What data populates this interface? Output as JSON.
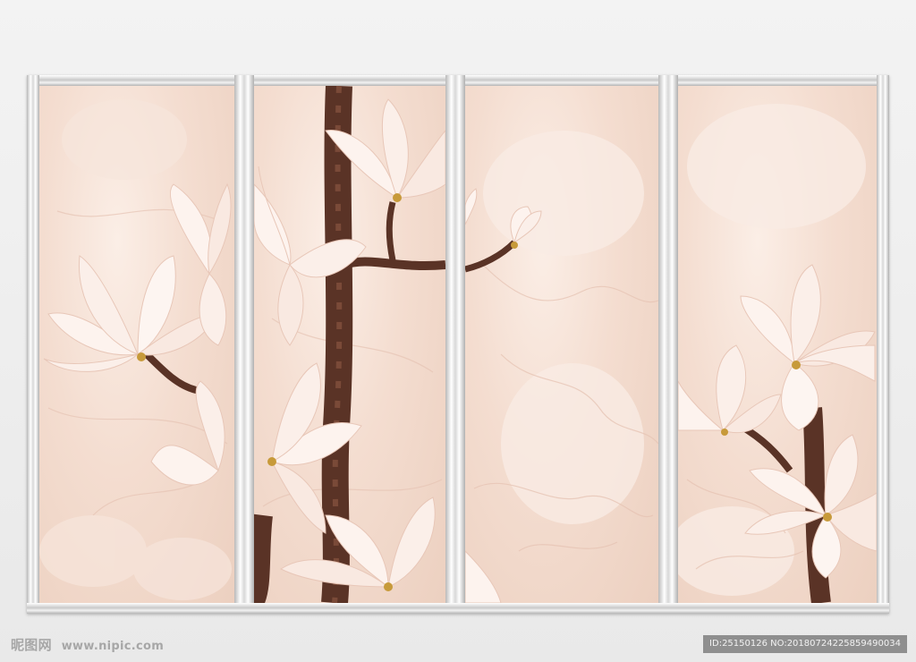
{
  "image": {
    "subject": "magnolia-mural-triptych",
    "panel_count": 4,
    "colors": {
      "background": "#eeeeee",
      "frame": "#d6d6d6",
      "marble": "#f4ddd0",
      "petal": "#fdf3ee",
      "petal_shadow": "#e8c7b8",
      "branch": "#5a3326",
      "stamen": "#c79a3a"
    }
  },
  "watermark": {
    "brand_cn": "昵图网",
    "site": "www.nipic.com",
    "id_text": "ID:25150126 NO:20180724225859490034"
  }
}
